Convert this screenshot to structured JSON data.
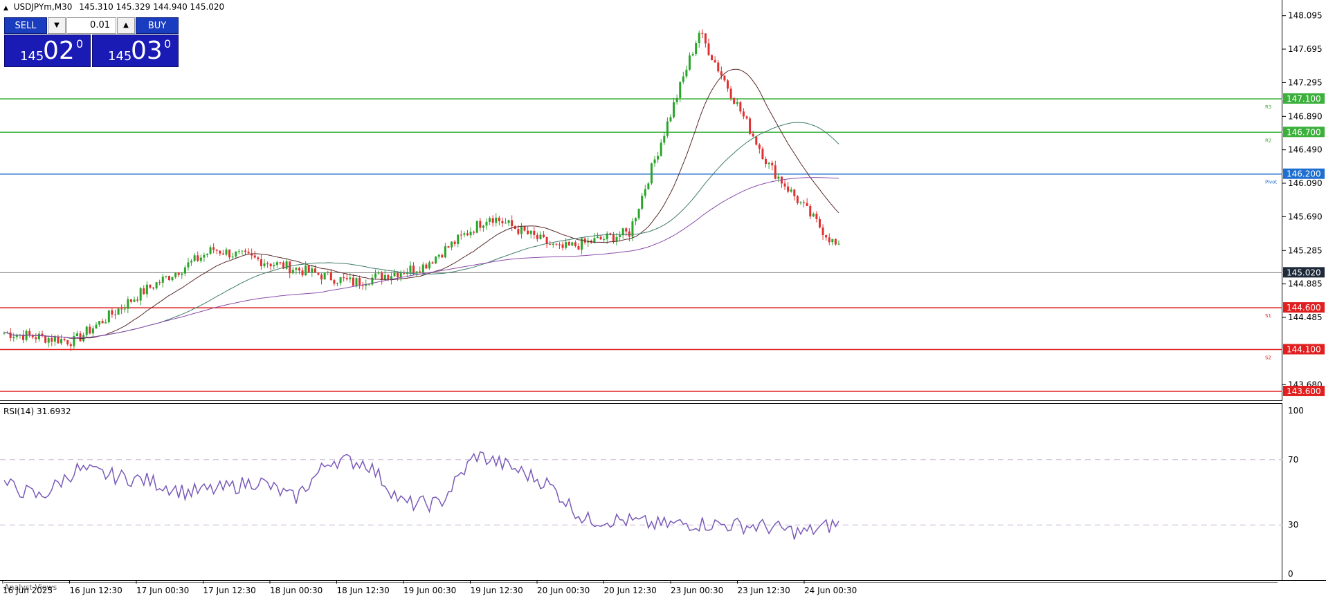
{
  "header": {
    "symbol": "USDJPYm,M30",
    "open": "145.310",
    "high": "145.329",
    "low": "144.940",
    "close": "145.020"
  },
  "trade_panel": {
    "sell_label": "SELL",
    "buy_label": "BUY",
    "lot_value": "0.01",
    "sell_small": "145",
    "sell_big": "02",
    "sell_sup": "0",
    "buy_small": "145",
    "buy_big": "03",
    "buy_sup": "0"
  },
  "price_axis": {
    "labels": [
      "148.095",
      "147.695",
      "147.295",
      "146.890",
      "146.490",
      "146.090",
      "145.690",
      "145.285",
      "144.885",
      "144.485",
      "143.680"
    ],
    "current_price": "145.020"
  },
  "levels": [
    {
      "price": 147.1,
      "label": "147.100",
      "tag": "R3",
      "color": "#3cb03c"
    },
    {
      "price": 146.7,
      "label": "146.700",
      "tag": "R2",
      "color": "#3cb03c"
    },
    {
      "price": 146.2,
      "label": "146.200",
      "tag": "Pivot",
      "color": "#1e6fcf"
    },
    {
      "price": 144.6,
      "label": "144.600",
      "tag": "S1",
      "color": "#e02020"
    },
    {
      "price": 144.1,
      "label": "144.100",
      "tag": "S2",
      "color": "#e02020"
    },
    {
      "price": 143.6,
      "label": "143.600",
      "tag": "",
      "color": "#e02020"
    }
  ],
  "rsi": {
    "label": "RSI(14) 31.6932",
    "axis_labels": [
      "100",
      "70",
      "30",
      "0"
    ]
  },
  "time_axis": {
    "labels": [
      "16 Jun 2025",
      "16 Jun 12:30",
      "17 Jun 00:30",
      "17 Jun 12:30",
      "18 Jun 00:30",
      "18 Jun 12:30",
      "19 Jun 00:30",
      "19 Jun 12:30",
      "20 Jun 00:30",
      "20 Jun 12:30",
      "23 Jun 00:30",
      "23 Jun 12:30",
      "24 Jun 00:30"
    ]
  },
  "analyst_tab": "Analyst Views",
  "colors": {
    "bull": "#2aa52a",
    "bear": "#e03030",
    "ma_fast": "#5a2a2a",
    "ma_mid": "#3e7a6a",
    "ma_slow": "#8a4aa8",
    "rsi_line": "#7a5ab8"
  },
  "chart_data": {
    "type": "line",
    "title": "",
    "series": [
      {
        "name": "",
        "x": [
          "16 Jun 2025",
          "16 Jun 12:30",
          "17 Jun 00:30",
          "17 Jun 12:30",
          "18 Jun 00:30",
          "18 Jun 12:30",
          "19 Jun 00:30",
          "19 Jun 12:30",
          "20 Jun 00:30",
          "20 Jun 12:30",
          "23 Jun 00:30",
          "23 Jun 12:30",
          "24 Jun 00:30"
        ],
        "values": [
          144.3,
          144.2,
          144.8,
          145.3,
          145.1,
          144.9,
          145.1,
          145.7,
          145.3,
          145.5,
          147.9,
          146.3,
          145.3
        ]
      }
    ],
    "ylim": [
      143.55,
      148.2
    ],
    "rsi_values_approx": [
      55,
      47,
      64,
      60,
      57,
      50,
      52,
      57,
      46,
      70,
      68,
      43,
      43,
      73,
      65,
      55,
      33,
      33,
      30,
      31,
      30,
      29,
      25,
      31
    ],
    "rsi_ylim": [
      0,
      100
    ]
  }
}
